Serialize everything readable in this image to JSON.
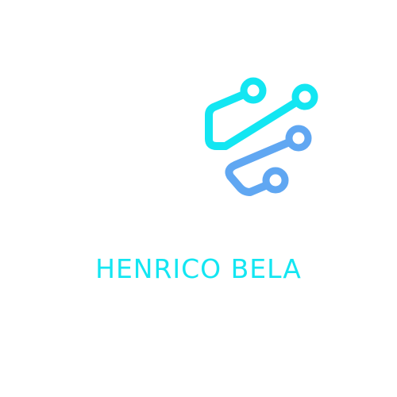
{
  "brand": {
    "name": "HENRICO BELA",
    "colors": {
      "cyan": "#13e6f2",
      "blue": "#60a7f2",
      "background": "#ffffff"
    }
  },
  "logo": {
    "icon": "circuit-nodes-icon"
  }
}
